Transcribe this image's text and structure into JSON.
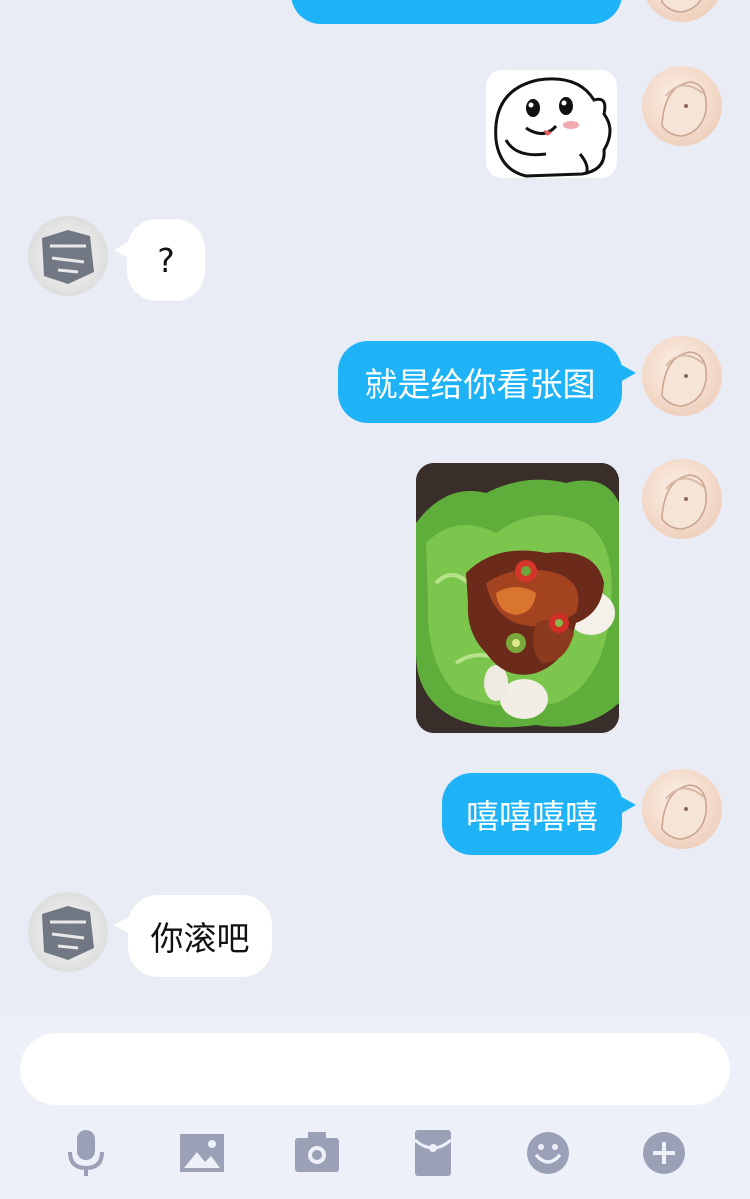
{
  "conversation": {
    "messages": [
      {
        "from": "me",
        "type": "text",
        "text": ""
      },
      {
        "from": "me",
        "type": "sticker",
        "sticker_icon": "cartoon-blob-sticker"
      },
      {
        "from": "friend",
        "type": "text",
        "text": "?"
      },
      {
        "from": "me",
        "type": "text",
        "text": "就是给你看张图"
      },
      {
        "from": "me",
        "type": "photo",
        "photo_icon": "grilled-pork-lettuce-photo"
      },
      {
        "from": "me",
        "type": "text",
        "text": "嘻嘻嘻嘻"
      },
      {
        "from": "friend",
        "type": "text",
        "text": "你滚吧"
      }
    ]
  },
  "composer": {
    "input_value": "",
    "toolbar": [
      "microphone-icon",
      "image-icon",
      "camera-icon",
      "red-packet-icon",
      "emoji-icon",
      "plus-icon"
    ]
  },
  "colors": {
    "outgoing_bubble": "#1eb3f6",
    "incoming_bubble": "#ffffff",
    "background": "#e9ebf5",
    "toolbar_icon": "#9aa1b6"
  }
}
